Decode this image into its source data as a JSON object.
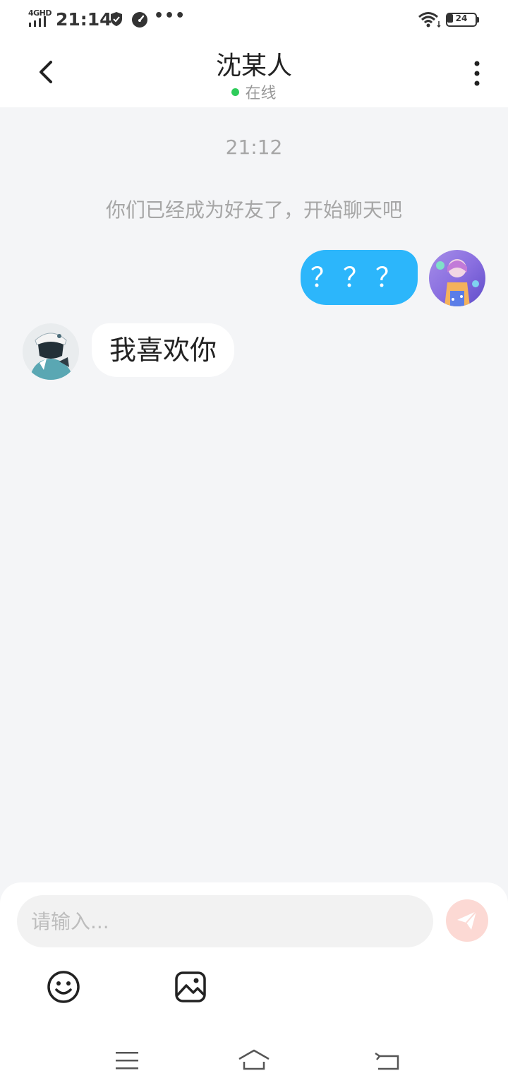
{
  "status_bar": {
    "network": "4GHD",
    "time": "21:14",
    "battery": "24",
    "more": "•••",
    "icons": [
      "signal-icon",
      "shield-icon",
      "speed-icon",
      "wifi-icon",
      "battery-icon"
    ]
  },
  "header": {
    "title": "沈某人",
    "status": "在线",
    "status_color": "#2ecc5a",
    "icons": [
      "back-arrow-icon",
      "more-vertical-icon"
    ]
  },
  "chat": {
    "time": "21:12",
    "system_notice": "你们已经成为好友了，开始聊天吧",
    "messages": [
      {
        "direction": "outgoing",
        "text": "？？？",
        "bubble_color": "#2cb6fb"
      },
      {
        "direction": "incoming",
        "text": "我喜欢你",
        "bubble_color": "#ffffff"
      }
    ]
  },
  "composer": {
    "placeholder": "请输入...",
    "value": "",
    "send_icon": "send-icon",
    "send_color": "#fcd9d4",
    "tools": [
      "emoji-icon",
      "image-icon"
    ]
  },
  "nav_bar": {
    "icons": [
      "menu-icon",
      "home-icon",
      "back-icon"
    ]
  }
}
